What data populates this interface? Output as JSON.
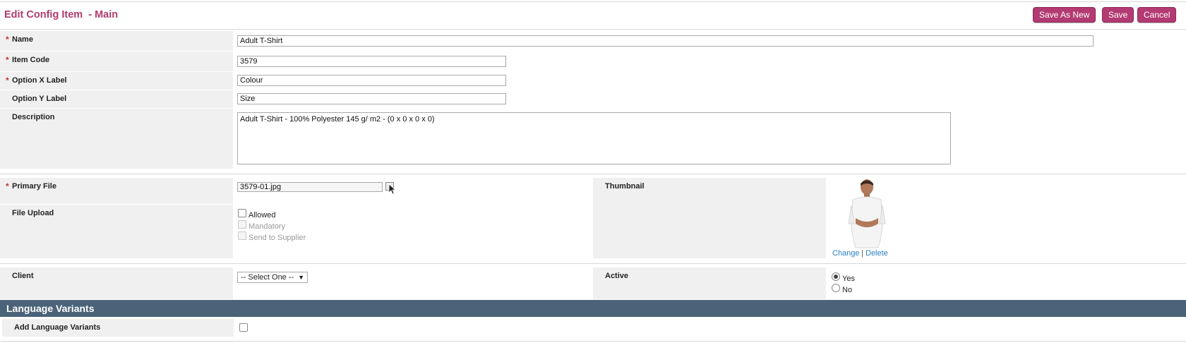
{
  "header": {
    "title": "Edit Config Item  - Main",
    "buttons": {
      "save_as_new": "Save As New",
      "save": "Save",
      "cancel": "Cancel"
    }
  },
  "fields": {
    "name": {
      "label": "Name",
      "required": "*",
      "value": "Adult T-Shirt"
    },
    "item_code": {
      "label": "Item Code",
      "required": "*",
      "value": "3579"
    },
    "option_x": {
      "label": "Option X Label",
      "required": "*",
      "value": "Colour"
    },
    "option_y": {
      "label": "Option Y Label",
      "value": "Size"
    },
    "description": {
      "label": "Description",
      "value": "Adult T-Shirt - 100% Polyester 145 g/ m2 - (0 x 0 x 0 x 0)"
    },
    "primary_file": {
      "label": "Primary File",
      "required": "*",
      "value": "3579-01.jpg"
    },
    "file_upload": {
      "label": "File Upload",
      "options": [
        {
          "label": "Allowed",
          "checked": false,
          "disabled": false
        },
        {
          "label": "Mandatory",
          "checked": false,
          "disabled": true
        },
        {
          "label": "Send to Supplier",
          "checked": false,
          "disabled": true
        }
      ]
    },
    "thumbnail": {
      "label": "Thumbnail",
      "change": "Change",
      "separator": "|",
      "delete": "Delete"
    },
    "client": {
      "label": "Client",
      "selected": "-- Select One --"
    },
    "active": {
      "label": "Active",
      "options": [
        {
          "label": "Yes",
          "checked": true
        },
        {
          "label": "No",
          "checked": false
        }
      ]
    }
  },
  "language_variants": {
    "title": "Language Variants",
    "add_label": "Add Language Variants"
  },
  "colors": {
    "accent": "#b33a72",
    "title": "#b03a6d",
    "section_bar": "#4a6378",
    "link": "#2a7fc4"
  }
}
